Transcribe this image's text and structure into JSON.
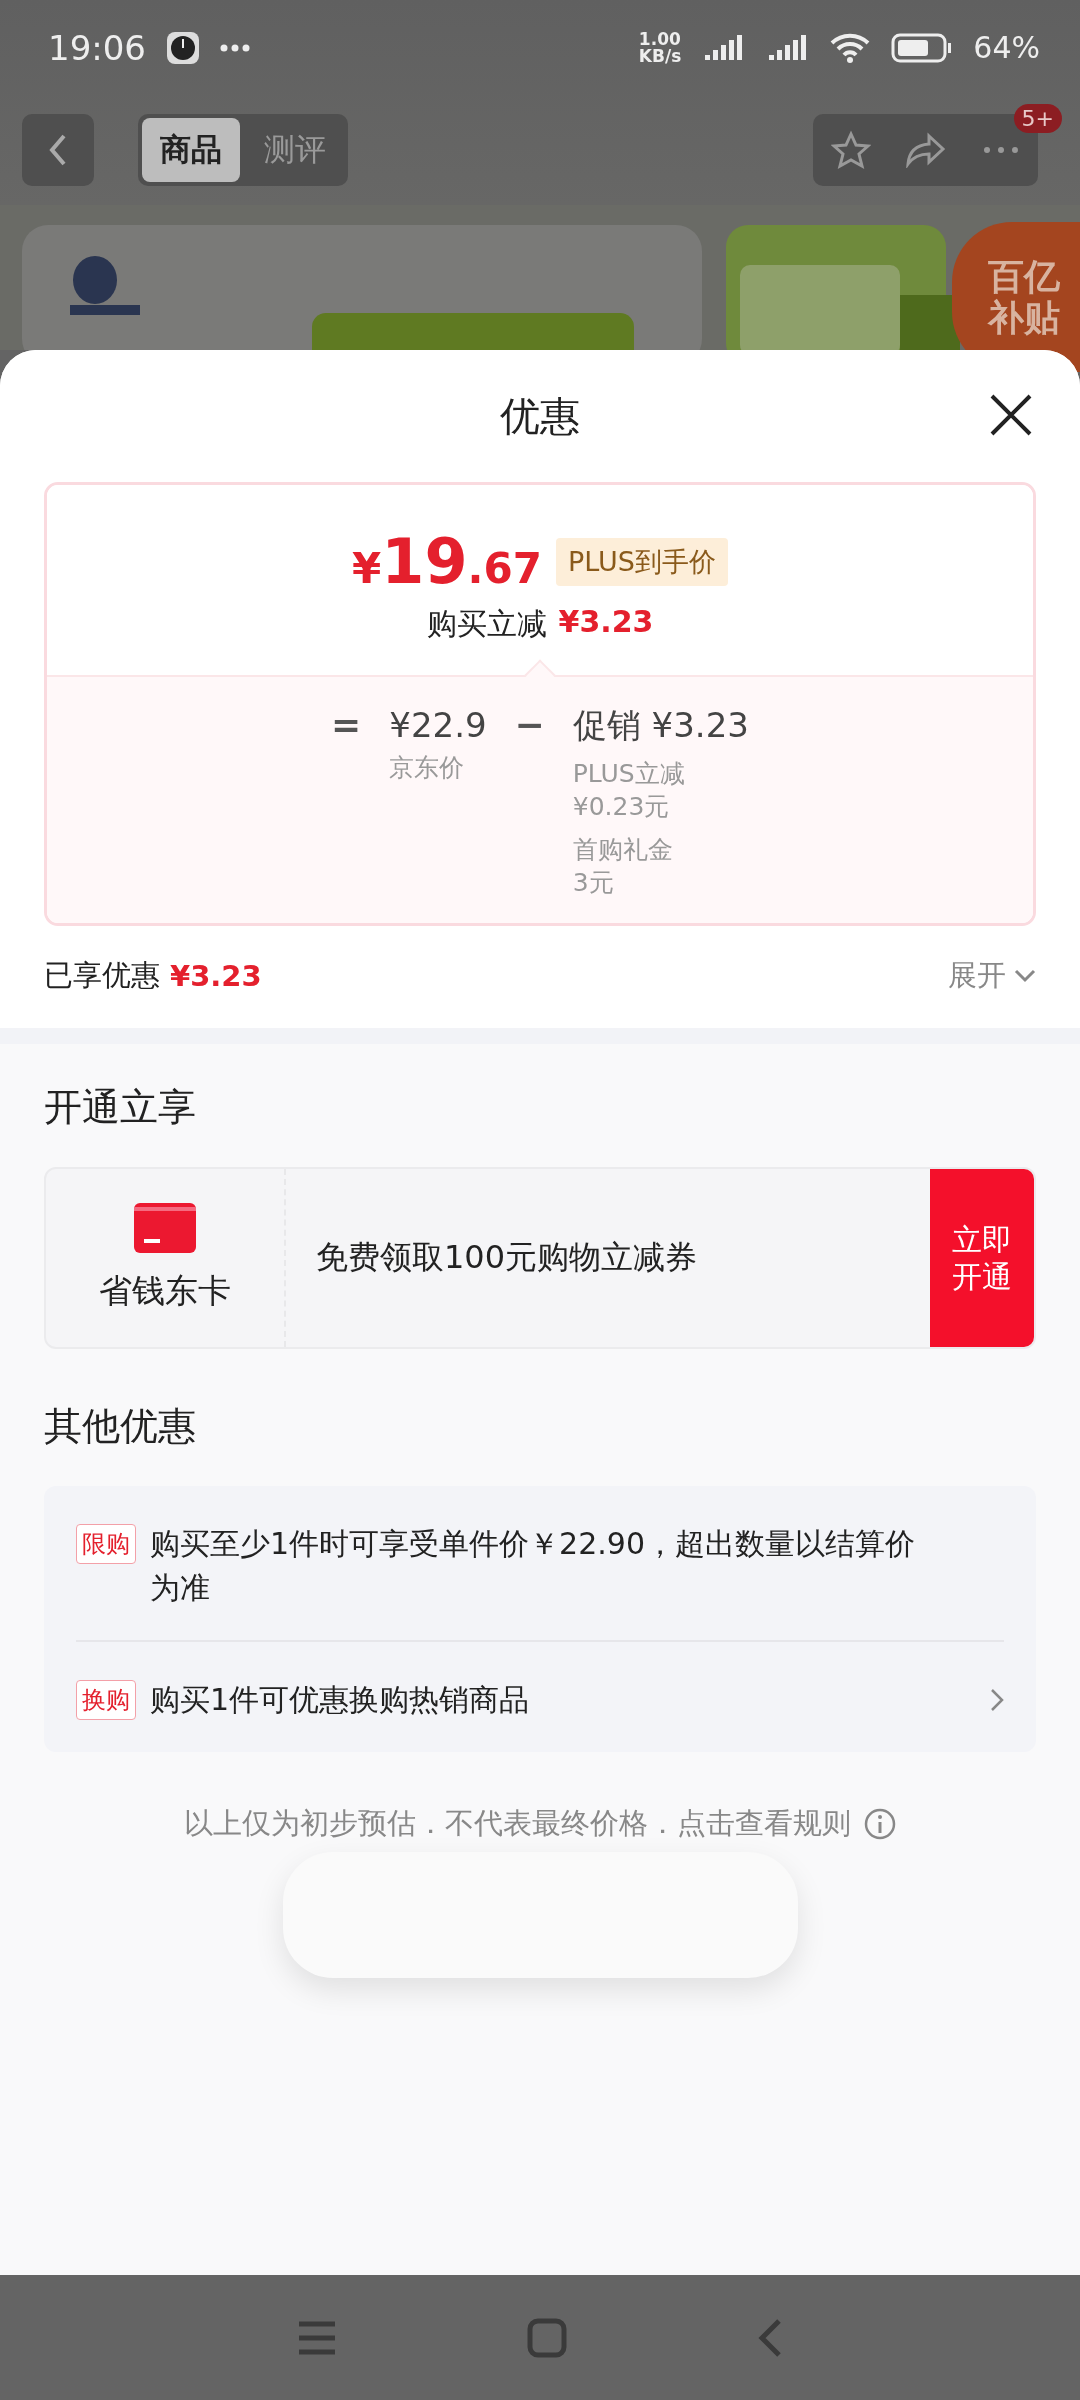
{
  "status_bar": {
    "time": "19:06",
    "net_speed": [
      "1.00",
      "KB/s"
    ],
    "battery": "64%"
  },
  "nav": {
    "tabs": [
      {
        "label": "商品",
        "selected": true
      },
      {
        "label": "测评",
        "selected": false
      }
    ],
    "badge": "5+"
  },
  "promo_badge": {
    "lines": [
      "百亿",
      "补贴"
    ]
  },
  "sheet": {
    "title": "优惠",
    "price": {
      "currency": "¥",
      "integer": "19",
      "decimal": ".67",
      "tag": "PLUS到手价",
      "saving_label": "购买立减",
      "saving": "¥3.23"
    },
    "breakdown": {
      "equals": "=",
      "base_price": "¥22.9",
      "base_label": "京东价",
      "minus": "−",
      "promo_label": "促销",
      "promo_amount": "¥3.23",
      "items": [
        {
          "name": "PLUS立减",
          "amount": "¥0.23元"
        },
        {
          "name": "首购礼金",
          "amount": "3元"
        }
      ]
    },
    "enjoyed": {
      "label": "已享优惠",
      "amount": "¥3.23",
      "expand": "展开"
    },
    "membership": {
      "heading": "开通立享",
      "card_name": "省钱东卡",
      "offer": "免费领取100元购物立减券",
      "button_lines": [
        "立即",
        "开通"
      ]
    },
    "others": {
      "heading": "其他优惠",
      "items": [
        {
          "tag": "限购",
          "text": "购买至少1件时可享受单件价￥22.90，超出数量以结算价为准",
          "has_arrow": false
        },
        {
          "tag": "换购",
          "text": "购买1件可优惠换购热销商品",
          "has_arrow": true
        }
      ]
    },
    "disclaimer": "以上仅为初步预估．不代表最终价格．点击查看规则"
  }
}
